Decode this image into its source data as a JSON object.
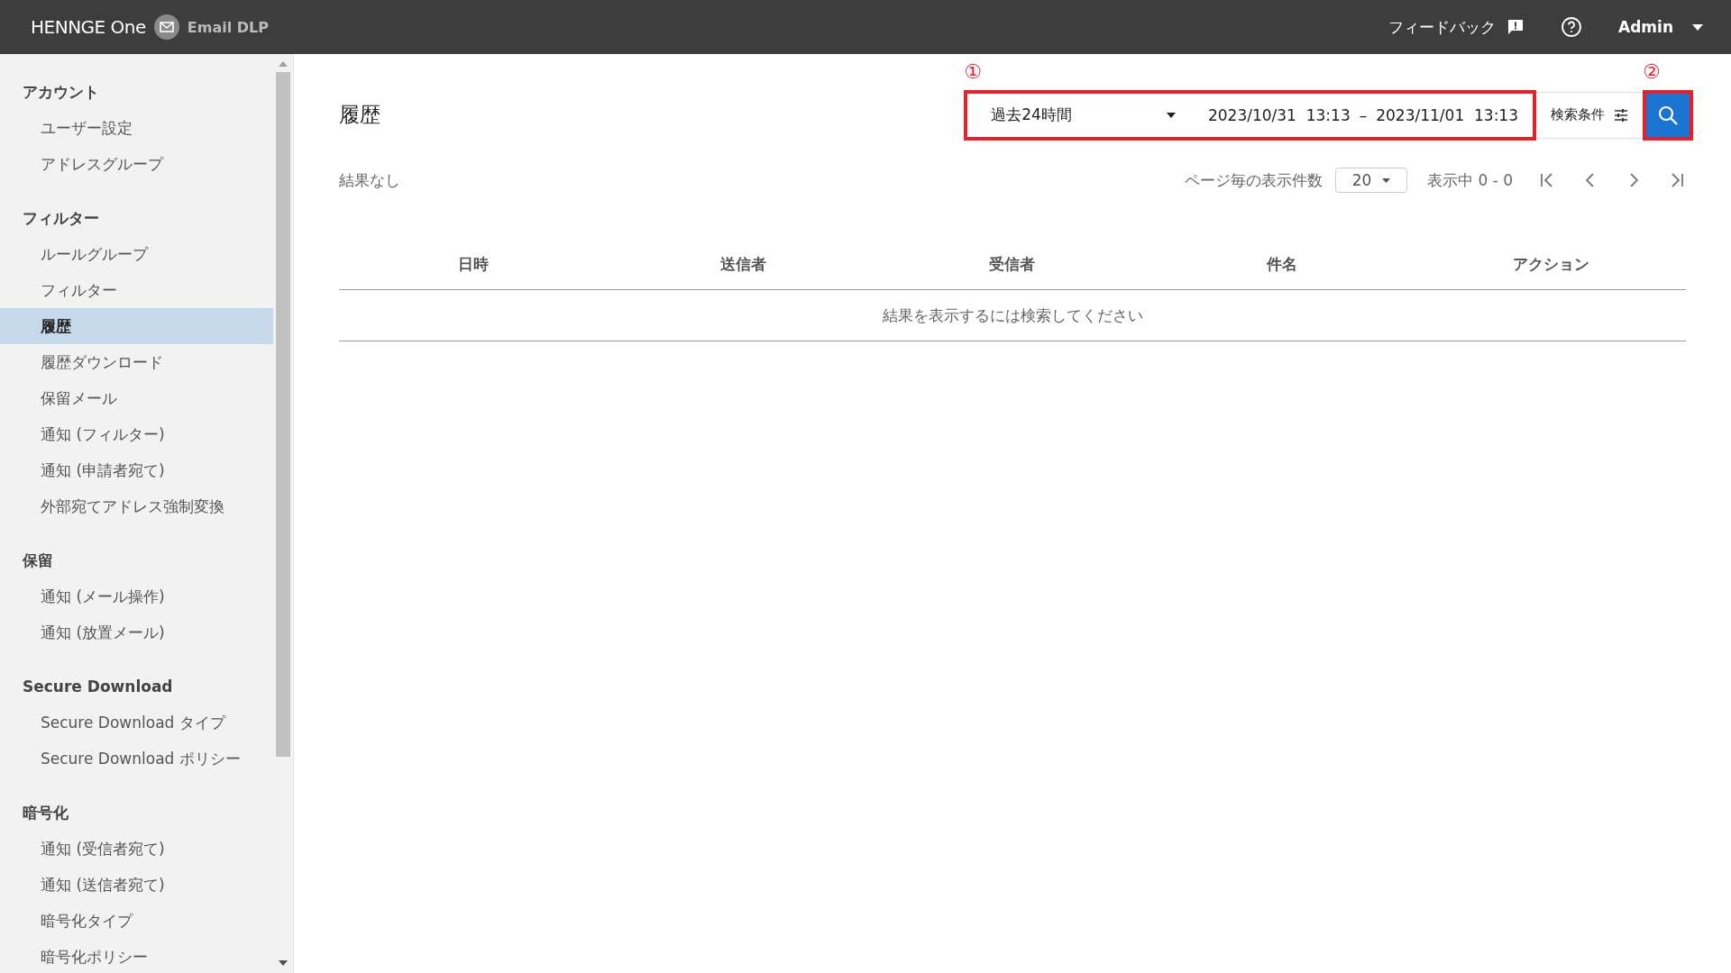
{
  "header": {
    "logo": "HENNGE One",
    "product": "Email DLP",
    "feedback": "フィードバック",
    "user": "Admin"
  },
  "sidebar": {
    "sections": [
      {
        "heading": "アカウント",
        "items": [
          {
            "label": "ユーザー設定",
            "selected": false
          },
          {
            "label": "アドレスグループ",
            "selected": false
          }
        ]
      },
      {
        "heading": "フィルター",
        "items": [
          {
            "label": "ルールグループ",
            "selected": false
          },
          {
            "label": "フィルター",
            "selected": false
          },
          {
            "label": "履歴",
            "selected": true
          },
          {
            "label": "履歴ダウンロード",
            "selected": false
          },
          {
            "label": "保留メール",
            "selected": false
          },
          {
            "label": "通知 (フィルター)",
            "selected": false
          },
          {
            "label": "通知 (申請者宛て)",
            "selected": false
          },
          {
            "label": "外部宛てアドレス強制変換",
            "selected": false
          }
        ]
      },
      {
        "heading": "保留",
        "items": [
          {
            "label": "通知 (メール操作)",
            "selected": false
          },
          {
            "label": "通知 (放置メール)",
            "selected": false
          }
        ]
      },
      {
        "heading": "Secure Download",
        "items": [
          {
            "label": "Secure Download タイプ",
            "selected": false
          },
          {
            "label": "Secure Download ポリシー",
            "selected": false
          }
        ]
      },
      {
        "heading": "暗号化",
        "items": [
          {
            "label": "通知 (受信者宛て)",
            "selected": false
          },
          {
            "label": "通知 (送信者宛て)",
            "selected": false
          },
          {
            "label": "暗号化タイプ",
            "selected": false
          },
          {
            "label": "暗号化ポリシー",
            "selected": false
          }
        ]
      }
    ]
  },
  "page": {
    "title": "履歴"
  },
  "search": {
    "period": "過去24時間",
    "range_start": "2023/10/31  13:13",
    "range_separator": "–",
    "range_end": "2023/11/01  13:13",
    "conditions_button": "検索条件"
  },
  "annotations": [
    {
      "label": "①"
    },
    {
      "label": "②"
    }
  ],
  "results": {
    "summary": "結果なし",
    "per_page_label": "ページ毎の表示件数",
    "per_page": "20",
    "showing": "表示中 0 - 0"
  },
  "table": {
    "columns": [
      "日時",
      "送信者",
      "受信者",
      "件名",
      "アクション"
    ],
    "empty_message": "結果を表示するには検索してください"
  }
}
